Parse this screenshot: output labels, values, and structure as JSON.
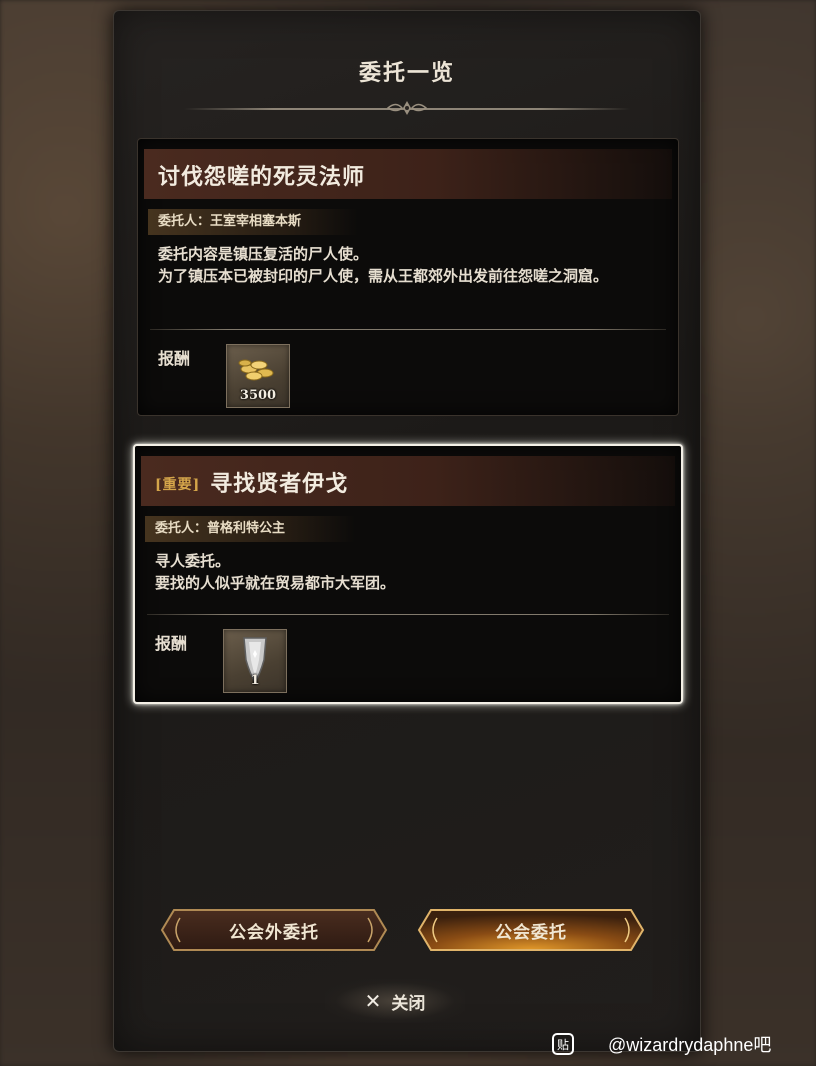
{
  "dialog": {
    "title": "委托一览"
  },
  "quests": [
    {
      "tag": "",
      "title": "讨伐怨嗟的死灵法师",
      "client": "委托人：王室宰相塞本斯",
      "description": [
        "委托内容是镇压复活的尸人使。",
        "为了镇压本已被封印的尸人使，需从王都郊外出发前往怨嗟之洞窟。"
      ],
      "reward_label": "报酬",
      "reward": {
        "icon": "gold-coins-icon",
        "quantity": "3500"
      }
    },
    {
      "tag": "[重要]",
      "title": "寻找贤者伊戈",
      "client": "委托人：普格利特公主",
      "description": [
        "寻人委托。",
        "要找的人似乎就在贸易都市大军团。"
      ],
      "reward_label": "报酬",
      "reward": {
        "icon": "shield-icon",
        "quantity": "1"
      }
    }
  ],
  "buttons": {
    "outside_guild": "公会外委托",
    "guild": "公会委托",
    "close": "关闭"
  },
  "watermark": {
    "icon_text": "贴",
    "text": "@wizardrydaphne吧"
  },
  "colors": {
    "selected_border": "#f4f0e6",
    "tag": "#d4a54a",
    "active_button": "#c07a1e"
  }
}
